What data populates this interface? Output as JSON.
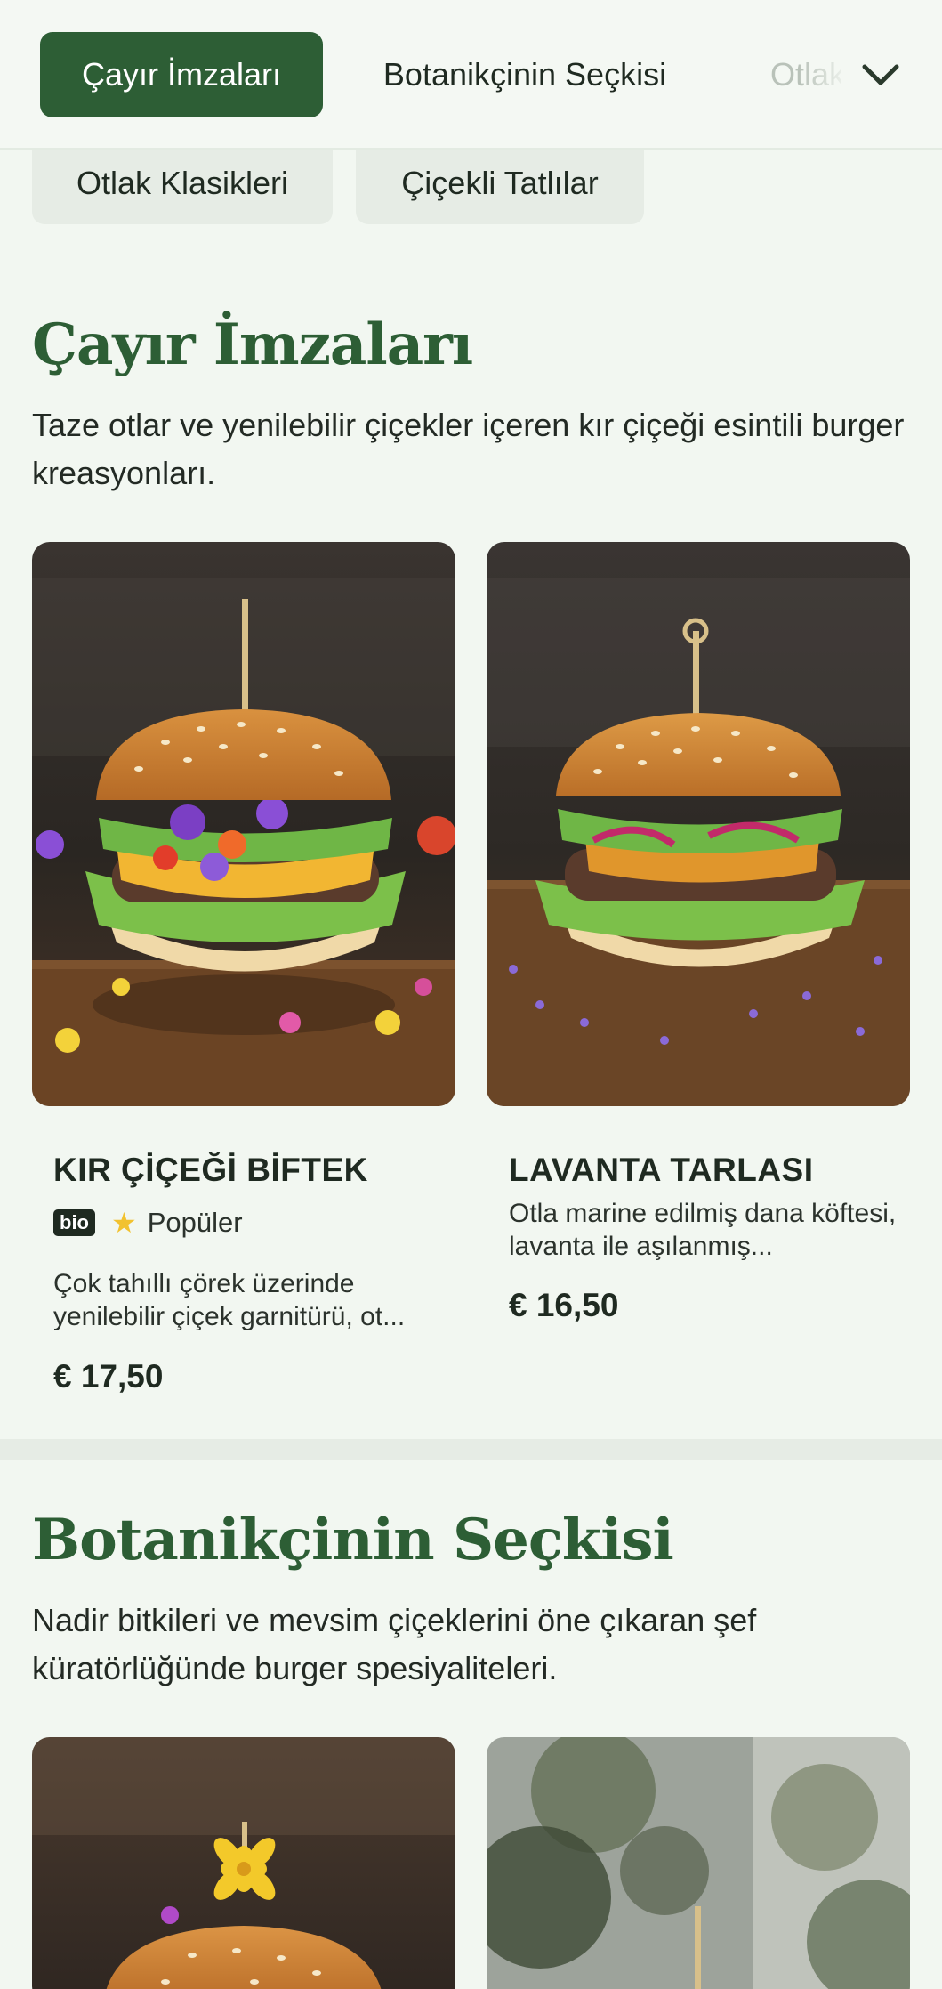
{
  "tabs": [
    {
      "label": "Çayır İmzaları",
      "active": true
    },
    {
      "label": "Botanikçinin Seçkisi",
      "active": false
    },
    {
      "label": "Otlak Klasikleri",
      "active": false
    }
  ],
  "tabs_more_icon": "chevron-down-icon",
  "chips": [
    "Otlak Klasikleri",
    "Çiçekli Tatlılar"
  ],
  "sections": [
    {
      "title": "Çayır İmzaları",
      "description": "Taze otlar ve yenilebilir çiçekler içeren kır çiçeği esintili burger kreasyonları.",
      "items": [
        {
          "name": "KIR ÇİÇEĞİ BİFTEK",
          "bio_badge": "bio",
          "star_icon": "star-icon",
          "popular_label": "Popüler",
          "description": "Çok tahıllı çörek üzerinde yenilebilir çiçek garnitürü, ot...",
          "price": "€ 17,50"
        },
        {
          "name": "LAVANTA TARLASI",
          "description": "Otla marine edilmiş dana köftesi, lavanta ile aşılanmış...",
          "price": "€ 16,50"
        }
      ]
    },
    {
      "title": "Botanikçinin Seçkisi",
      "description": "Nadir bitkileri ve mevsim çiçeklerini öne çıkaran şef küratörlüğünde burger spesiyaliteleri."
    }
  ],
  "colors": {
    "accent": "#2d5e35",
    "background": "#f2f7f1",
    "chip_bg": "#e6ece5",
    "star": "#f2c230"
  }
}
